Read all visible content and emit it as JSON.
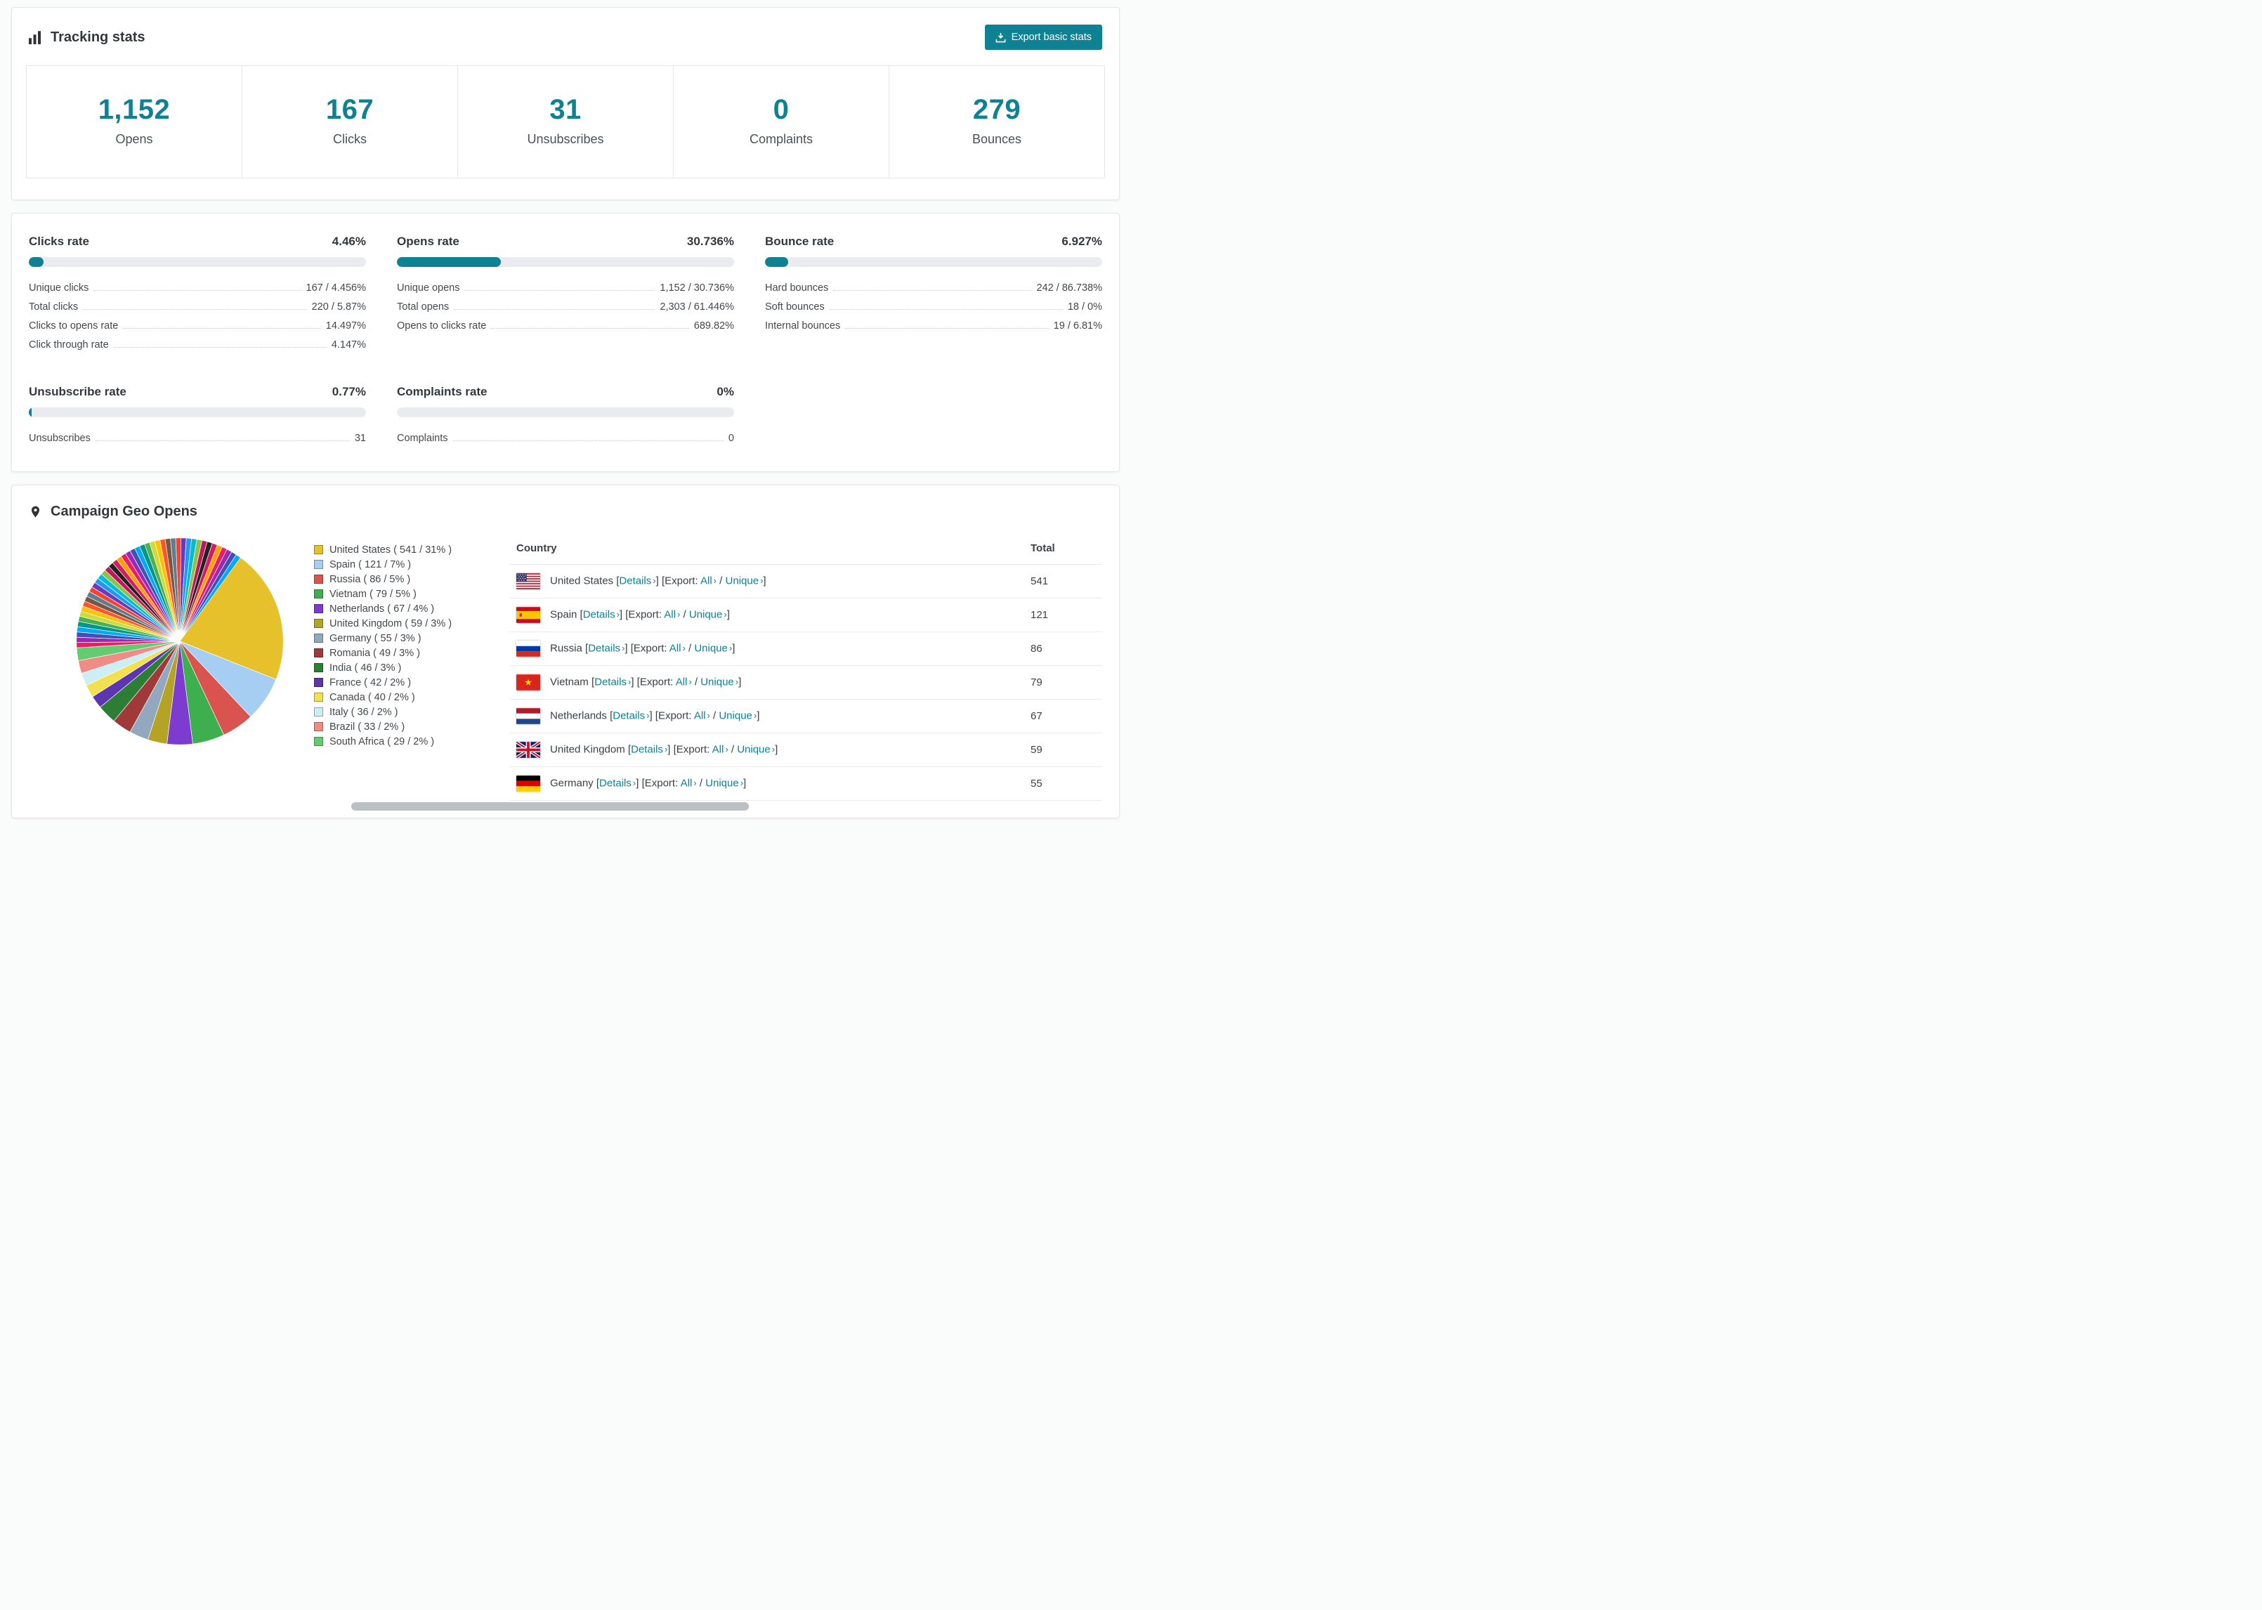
{
  "colors": {
    "accent": "#0e8192",
    "bar_track": "#e9ebee"
  },
  "tracking": {
    "title": "Tracking stats",
    "export_button": "Export basic stats",
    "stats": [
      {
        "value": "1,152",
        "label": "Opens"
      },
      {
        "value": "167",
        "label": "Clicks"
      },
      {
        "value": "31",
        "label": "Unsubscribes"
      },
      {
        "value": "0",
        "label": "Complaints"
      },
      {
        "value": "279",
        "label": "Bounces"
      }
    ]
  },
  "rates": [
    {
      "title": "Clicks rate",
      "value": "4.46%",
      "percent": 4.46,
      "rows": [
        [
          "Unique clicks",
          "167 / 4.456%"
        ],
        [
          "Total clicks",
          "220 / 5.87%"
        ],
        [
          "Clicks to opens rate",
          "14.497%"
        ],
        [
          "Click through rate",
          "4.147%"
        ]
      ]
    },
    {
      "title": "Opens rate",
      "value": "30.736%",
      "percent": 30.736,
      "rows": [
        [
          "Unique opens",
          "1,152 / 30.736%"
        ],
        [
          "Total opens",
          "2,303 / 61.446%"
        ],
        [
          "Opens to clicks rate",
          "689.82%"
        ]
      ]
    },
    {
      "title": "Bounce rate",
      "value": "6.927%",
      "percent": 6.927,
      "rows": [
        [
          "Hard bounces",
          "242 / 86.738%"
        ],
        [
          "Soft bounces",
          "18 / 0%"
        ],
        [
          "Internal bounces",
          "19 / 6.81%"
        ]
      ]
    },
    {
      "title": "Unsubscribe rate",
      "value": "0.77%",
      "percent": 0.77,
      "rows": [
        [
          "Unsubscribes",
          "31"
        ]
      ]
    },
    {
      "title": "Complaints rate",
      "value": "0%",
      "percent": 0,
      "rows": [
        [
          "Complaints",
          "0"
        ]
      ]
    }
  ],
  "geo": {
    "title": "Campaign Geo Opens",
    "chart_data": {
      "type": "pie",
      "title": "Campaign Geo Opens",
      "legend_position": "right",
      "slices": [
        {
          "label": "United States",
          "value": 541,
          "percent": 31,
          "color": "#e7c12b"
        },
        {
          "label": "Spain",
          "value": 121,
          "percent": 7,
          "color": "#a6cdf2"
        },
        {
          "label": "Russia",
          "value": 86,
          "percent": 5,
          "color": "#d9534f"
        },
        {
          "label": "Vietnam",
          "value": 79,
          "percent": 5,
          "color": "#3daf4f"
        },
        {
          "label": "Netherlands",
          "value": 67,
          "percent": 4,
          "color": "#7d3bd0"
        },
        {
          "label": "United Kingdom",
          "value": 59,
          "percent": 3,
          "color": "#b4a325"
        },
        {
          "label": "Germany",
          "value": 55,
          "percent": 3,
          "color": "#92a8bf"
        },
        {
          "label": "Romania",
          "value": 49,
          "percent": 3,
          "color": "#a03a3a"
        },
        {
          "label": "India",
          "value": 46,
          "percent": 3,
          "color": "#2c7d36"
        },
        {
          "label": "France",
          "value": 42,
          "percent": 2,
          "color": "#5e35b1"
        },
        {
          "label": "Canada",
          "value": 40,
          "percent": 2,
          "color": "#f2e04e"
        },
        {
          "label": "Italy",
          "value": 36,
          "percent": 2,
          "color": "#cdeef5"
        },
        {
          "label": "Brazil",
          "value": 33,
          "percent": 2,
          "color": "#f08c86"
        },
        {
          "label": "South Africa",
          "value": 29,
          "percent": 2,
          "color": "#63cc70"
        }
      ],
      "other": {
        "percent": 36,
        "slice_count": 44,
        "colors": [
          "#e91e63",
          "#9c27b0",
          "#3f51b5",
          "#03a9f4",
          "#009688",
          "#4caf50",
          "#cddc39",
          "#ffc107",
          "#ff5722",
          "#795548",
          "#607d8b",
          "#f44336",
          "#673ab7",
          "#2196f3",
          "#00bcd4",
          "#8bc34a",
          "#c2185b",
          "#222222",
          "#d81b60",
          "#ffa000"
        ]
      }
    },
    "table": {
      "headers": [
        "Country",
        "Total"
      ],
      "link_labels": {
        "details": "Details",
        "export": "Export:",
        "all": "All",
        "unique": "Unique",
        "open_bracket": "[",
        "close_bracket": "]",
        "slash": "/",
        "chevron": "›"
      },
      "rows": [
        {
          "country": "United States",
          "flag": "us",
          "total": "541"
        },
        {
          "country": "Spain",
          "flag": "es",
          "total": "121"
        },
        {
          "country": "Russia",
          "flag": "ru",
          "total": "86"
        },
        {
          "country": "Vietnam",
          "flag": "vn",
          "total": "79"
        },
        {
          "country": "Netherlands",
          "flag": "nl",
          "total": "67"
        },
        {
          "country": "United Kingdom",
          "flag": "gb",
          "total": "59"
        },
        {
          "country": "Germany",
          "flag": "de",
          "total": "55"
        }
      ]
    }
  }
}
